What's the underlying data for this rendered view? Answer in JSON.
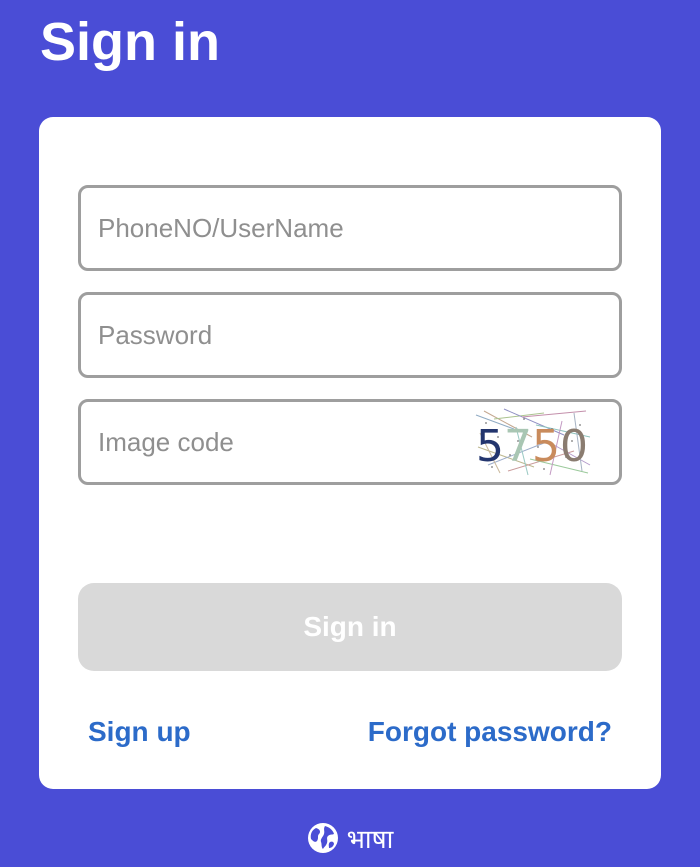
{
  "page": {
    "title": "Sign in"
  },
  "form": {
    "phone_placeholder": "PhoneNO/UserName",
    "phone_value": "",
    "password_placeholder": "Password",
    "password_value": "",
    "image_code_placeholder": "Image code",
    "image_code_value": "",
    "captcha_text": "5750",
    "submit_label": "Sign in"
  },
  "links": {
    "signup": "Sign up",
    "forgot_password": "Forgot password?"
  },
  "footer": {
    "language_label": "भाषा",
    "language_icon": "globe-icon"
  },
  "colors": {
    "background": "#4a4dd6",
    "card": "#ffffff",
    "link": "#2c6bc9",
    "button_disabled": "#d9d9d9",
    "field_border": "#9e9e9e"
  }
}
